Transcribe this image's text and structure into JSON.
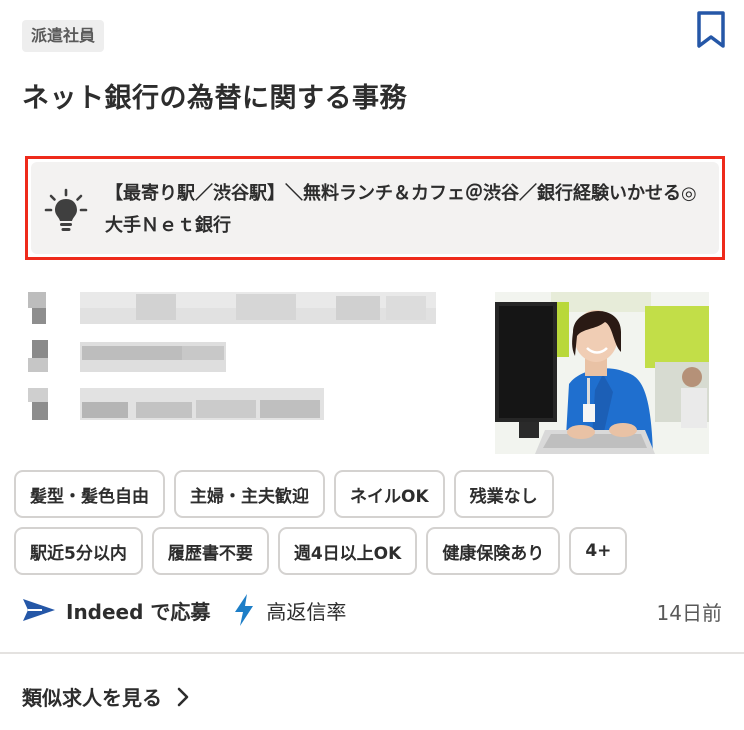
{
  "job": {
    "employment_type": "派遣社員",
    "title": "ネット銀行の為替に関する事務",
    "snippet": "【最寄り駅／渋谷駅】＼無料ランチ＆カフェ＠渋谷／銀行経験いかせる◎大手Ｎｅｔ銀行",
    "tags_row1": [
      "髪型・髪色自由",
      "主婦・主夫歓迎",
      "ネイルOK",
      "残業なし"
    ],
    "tags_row2": [
      "駅近5分以内",
      "履歴書不要",
      "週4日以上OK",
      "健康保険あり",
      "4+"
    ],
    "apply_label": "Indeed で応募",
    "response_label": "高返信率",
    "posted": "14日前"
  },
  "footer": {
    "similar_jobs": "類似求人を見る"
  },
  "icons": {
    "bookmark": "bookmark-icon",
    "bulb": "lightbulb-icon",
    "apply": "send-arrow-icon",
    "response": "lightning-bolt-icon",
    "chevron": "chevron-right-icon"
  },
  "colors": {
    "accent_blue": "#2557a7",
    "highlight_border": "#ee2a1b",
    "bolt": "#1d7ec7"
  }
}
